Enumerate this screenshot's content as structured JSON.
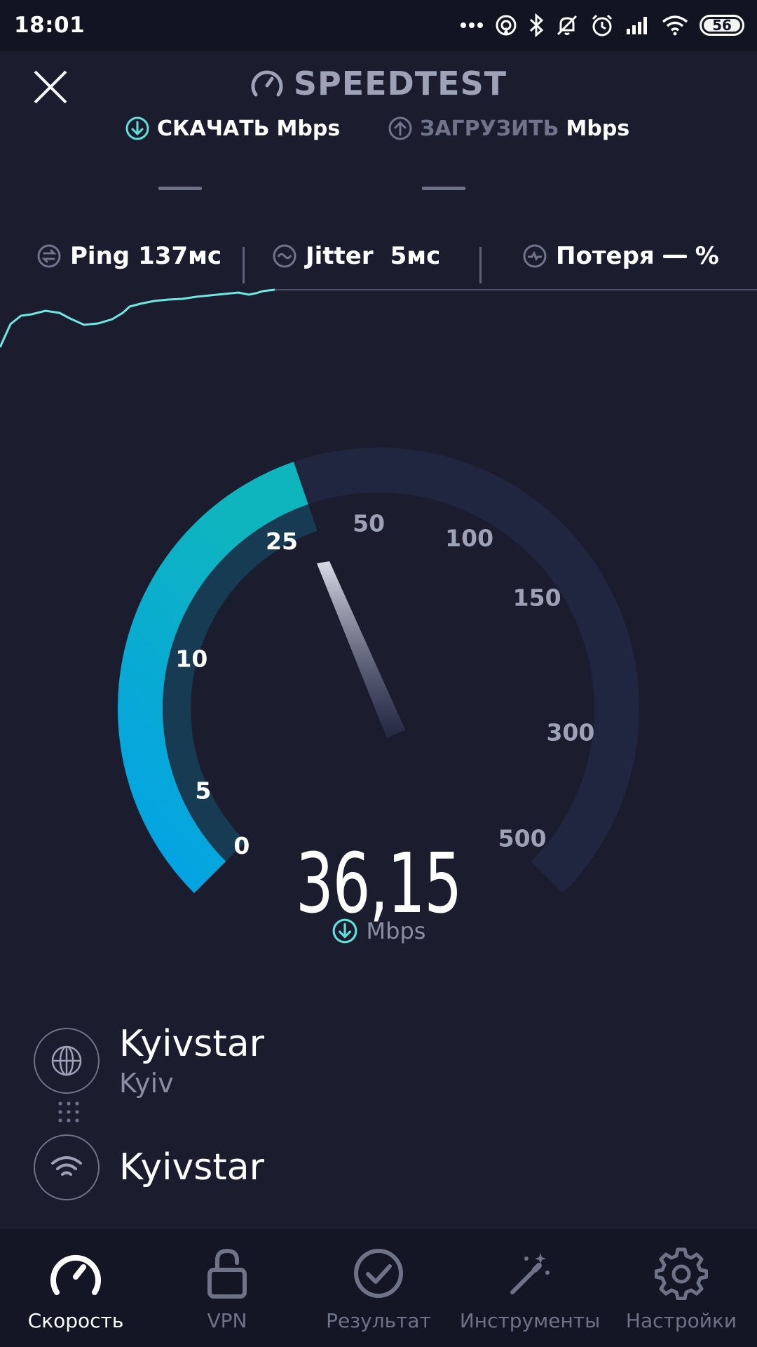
{
  "status_bar": {
    "time": "18:01",
    "battery": "56",
    "icons": [
      "more-dots-icon",
      "hotspot-icon",
      "bluetooth-icon",
      "mute-icon",
      "alarm-icon",
      "signal-icon",
      "wifi-icon",
      "battery-icon"
    ]
  },
  "header": {
    "title": "SPEEDTEST",
    "close_icon": "close-icon",
    "logo_icon": "speedometer-icon"
  },
  "tabs": {
    "download": {
      "label": "СКАЧАТЬ",
      "unit": "Mbps",
      "icon": "download-arrow-icon"
    },
    "upload": {
      "label": "ЗАГРУЗИТЬ",
      "unit": "Mbps",
      "icon": "upload-arrow-icon"
    }
  },
  "metrics": {
    "ping": {
      "label": "Ping",
      "value": "137мс",
      "icon": "ping-icon"
    },
    "jitter": {
      "label": "Jitter",
      "value": "5мс",
      "icon": "jitter-icon"
    },
    "loss": {
      "label": "Потеря",
      "value": "%",
      "icon": "loss-icon"
    }
  },
  "gauge": {
    "ticks": [
      "0",
      "5",
      "10",
      "25",
      "50",
      "100",
      "150",
      "300",
      "500"
    ],
    "active_ticks": [
      "0",
      "5",
      "10",
      "25"
    ],
    "colors": {
      "active_start": "#03a2e6",
      "active_end": "#0fb5bd",
      "inactive": "#212640",
      "graph_line": "#6ee8e0"
    }
  },
  "reading": {
    "value": "36,15",
    "unit": "Mbps"
  },
  "servers": {
    "host": {
      "name": "Kyivstar",
      "location": "Kyiv",
      "icon": "globe-icon"
    },
    "provider": {
      "name": "Kyivstar",
      "icon": "wifi-icon"
    }
  },
  "bottom_nav": {
    "items": [
      {
        "label": "Скорость",
        "icon": "speedometer-icon",
        "active": true
      },
      {
        "label": "VPN",
        "icon": "unlock-icon",
        "active": false
      },
      {
        "label": "Результат",
        "icon": "check-circle-icon",
        "active": false
      },
      {
        "label": "Инструменты",
        "icon": "magic-wand-icon",
        "active": false
      },
      {
        "label": "Настройки",
        "icon": "gear-icon",
        "active": false
      }
    ]
  }
}
